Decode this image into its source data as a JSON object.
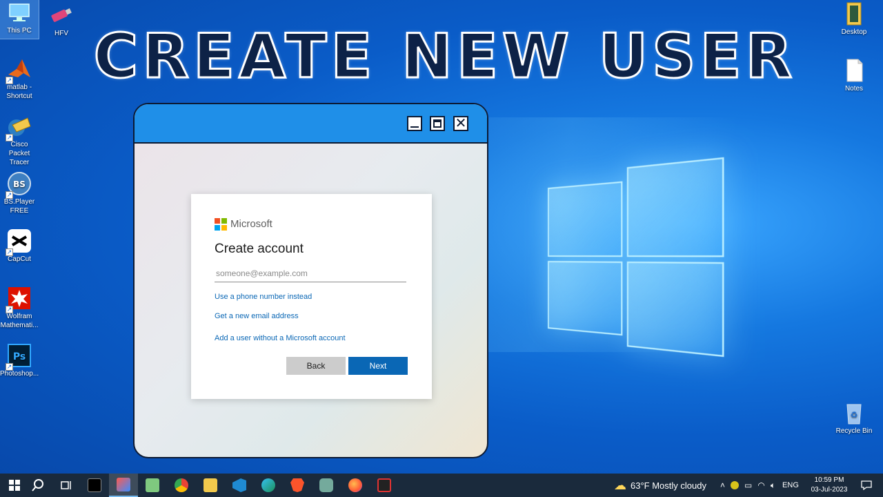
{
  "headline": "CREATE NEW USER",
  "desktop_icons_left": [
    {
      "label": "This PC",
      "icon": "this-pc-icon"
    },
    {
      "label": "HFV",
      "icon": "usb-drive-icon"
    },
    {
      "label": "matlab - Shortcut",
      "icon": "matlab-icon"
    },
    {
      "label": "Cisco Packet Tracer",
      "icon": "cisco-packet-tracer-icon"
    },
    {
      "label": "BS.Player FREE",
      "icon": "bsplayer-icon"
    },
    {
      "label": "CapCut",
      "icon": "capcut-icon"
    },
    {
      "label": "Wolfram Mathemati...",
      "icon": "wolfram-icon"
    },
    {
      "label": "Photoshop...",
      "icon": "photoshop-icon"
    }
  ],
  "desktop_icons_right": [
    {
      "label": "Desktop",
      "icon": "folder-icon"
    },
    {
      "label": "Notes",
      "icon": "text-file-icon"
    },
    {
      "label": "Recycle Bin",
      "icon": "recycle-bin-icon"
    }
  ],
  "dialog": {
    "brand": "Microsoft",
    "title": "Create account",
    "email_placeholder": "someone@example.com",
    "email_value": "",
    "link_phone": "Use a phone number instead",
    "link_new_email": "Get a new email address",
    "link_no_account": "Add a user without a Microsoft account",
    "back_label": "Back",
    "next_label": "Next"
  },
  "taskbar": {
    "apps": [
      "search-icon",
      "task-view-icon",
      "terminal-icon",
      "bluestacks-icon",
      "notepad-icon",
      "chrome-icon",
      "file-explorer-icon",
      "vscode-icon",
      "edge-icon",
      "brave-icon",
      "chatgpt-icon",
      "firefox-icon",
      "screen-recorder-icon"
    ],
    "weather": "63°F  Mostly cloudy",
    "language": "ENG",
    "time": "10:59 PM",
    "date": "03-Jul-2023"
  },
  "colors": {
    "accent_blue": "#0a67b5",
    "titlebar": "#1f8fe8",
    "headline": "#0d2247"
  }
}
